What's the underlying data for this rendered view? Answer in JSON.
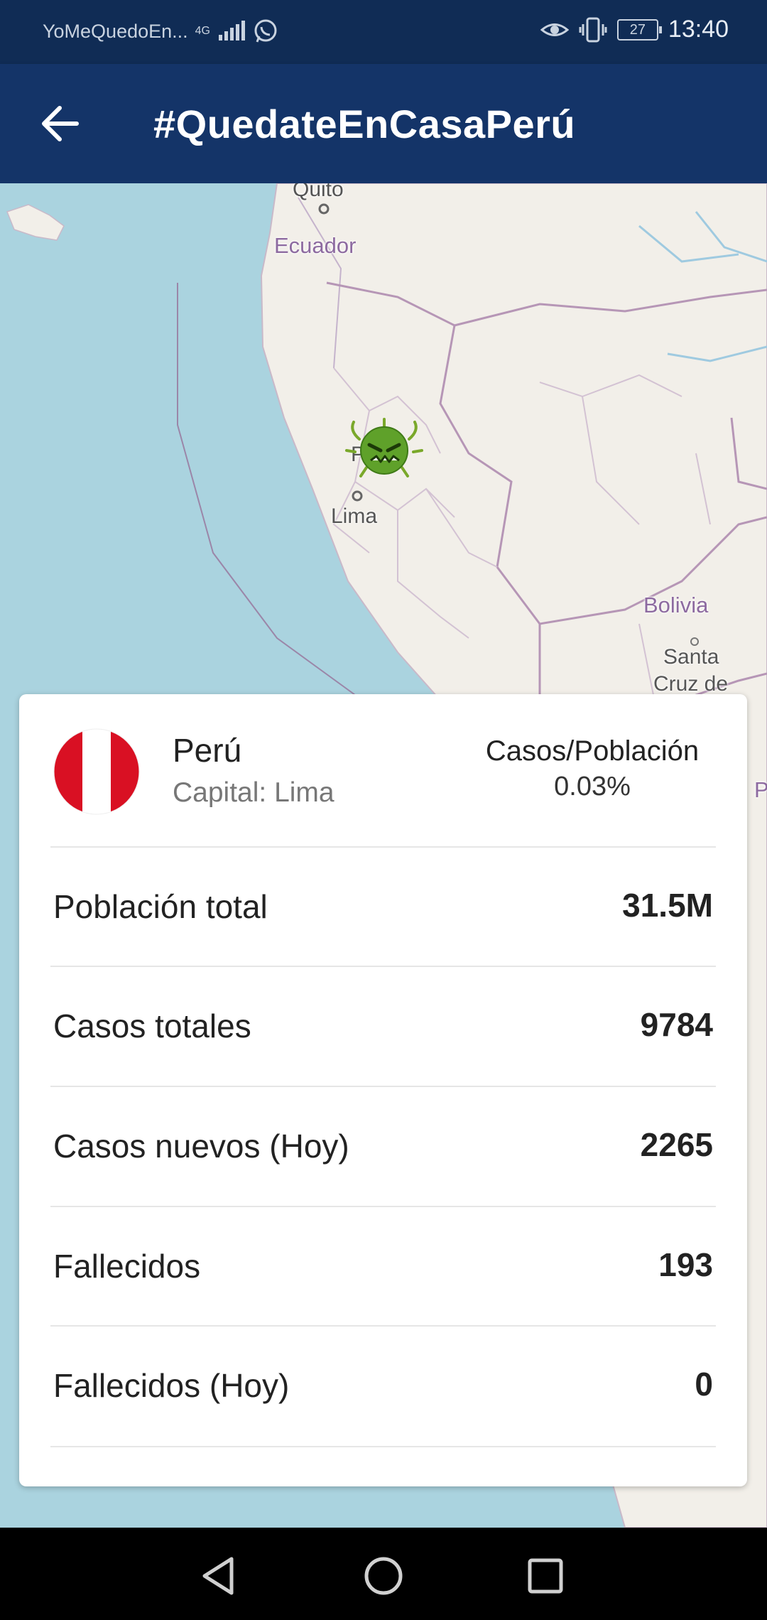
{
  "status_bar": {
    "app_name": "YoMeQuedoEn...",
    "network": "4G",
    "battery": "27",
    "time": "13:40"
  },
  "app_bar": {
    "title": "#QuedateEnCasaPerú",
    "back_icon": "arrow-left-icon"
  },
  "map": {
    "labels": {
      "quito": "Quito",
      "ecuador": "Ecuador",
      "lima": "Lima",
      "bolivia": "Bolivia",
      "santa": "Santa",
      "cruz": "Cruz de",
      "peru_partial": "P",
      "edge_partial": "P"
    },
    "marker_icon": "virus-icon"
  },
  "card": {
    "country": "Perú",
    "capital": "Capital: Lima",
    "ratio_label": "Casos/Población",
    "ratio_value": "0.03%",
    "flag_colors": {
      "red": "#d91023",
      "white": "#ffffff"
    },
    "stats": [
      {
        "label": "Población total",
        "value": "31.5M"
      },
      {
        "label": "Casos totales",
        "value": "9784"
      },
      {
        "label": "Casos nuevos (Hoy)",
        "value": "2265"
      },
      {
        "label": "Fallecidos",
        "value": "193"
      },
      {
        "label": "Fallecidos (Hoy)",
        "value": "0"
      }
    ]
  },
  "nav_bar": {
    "back": "triangle-back-icon",
    "home": "circle-home-icon",
    "recents": "square-recents-icon"
  }
}
